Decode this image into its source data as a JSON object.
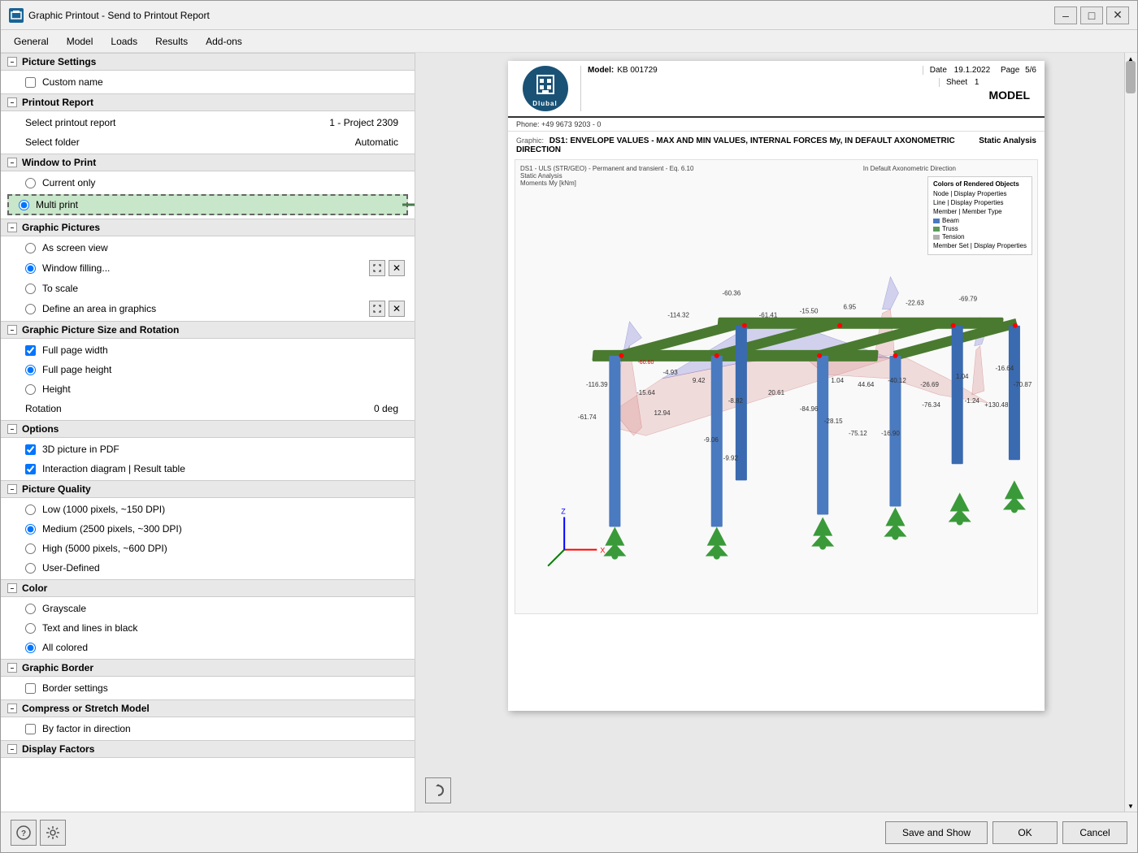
{
  "window": {
    "title": "Graphic Printout - Send to Printout Report",
    "icon": "printer-icon"
  },
  "menu": {
    "items": [
      "General",
      "Model",
      "Loads",
      "Results",
      "Add-ons"
    ]
  },
  "title_controls": [
    "minimize",
    "maximize",
    "close"
  ],
  "sections": {
    "picture_settings": {
      "label": "Picture Settings",
      "custom_name": {
        "label": "Custom name",
        "checked": false
      }
    },
    "printout_report": {
      "label": "Printout Report",
      "select_report": {
        "label": "Select printout report",
        "value": "1 - Project 2309"
      },
      "select_folder": {
        "label": "Select folder",
        "value": "Automatic"
      }
    },
    "window_to_print": {
      "label": "Window to Print",
      "current_only": {
        "label": "Current only",
        "checked": false
      },
      "multi_print": {
        "label": "Multi print",
        "checked": true
      }
    },
    "graphic_pictures": {
      "label": "Graphic Pictures",
      "as_screen_view": {
        "label": "As screen view",
        "checked": false
      },
      "window_filling": {
        "label": "Window filling...",
        "checked": true
      },
      "to_scale": {
        "label": "To scale",
        "checked": false
      },
      "define_area": {
        "label": "Define an area in graphics",
        "checked": false
      }
    },
    "size_rotation": {
      "label": "Graphic Picture Size and Rotation",
      "full_page_width": {
        "label": "Full page width",
        "checked": true
      },
      "full_page_height": {
        "label": "Full page height",
        "checked": true
      },
      "height": {
        "label": "Height",
        "checked": false
      },
      "rotation": {
        "label": "Rotation",
        "value": "0",
        "unit": "deg"
      }
    },
    "options": {
      "label": "Options",
      "pdf_3d": {
        "label": "3D picture in PDF",
        "checked": true
      },
      "interaction_diagram": {
        "label": "Interaction diagram | Result table",
        "checked": true
      }
    },
    "picture_quality": {
      "label": "Picture Quality",
      "low": {
        "label": "Low (1000 pixels, ~150 DPI)",
        "checked": false
      },
      "medium": {
        "label": "Medium (2500 pixels, ~300 DPI)",
        "checked": true
      },
      "high": {
        "label": "High (5000 pixels, ~600 DPI)",
        "checked": false
      },
      "user_defined": {
        "label": "User-Defined",
        "checked": false
      }
    },
    "color": {
      "label": "Color",
      "grayscale": {
        "label": "Grayscale",
        "checked": false
      },
      "text_lines_black": {
        "label": "Text and lines in black",
        "checked": false
      },
      "all_colored": {
        "label": "All colored",
        "checked": true
      }
    },
    "graphic_border": {
      "label": "Graphic Border",
      "border_settings": {
        "label": "Border settings",
        "checked": false
      }
    },
    "compress_stretch": {
      "label": "Compress or Stretch Model",
      "by_factor": {
        "label": "By factor in direction",
        "checked": false
      }
    },
    "display_factors": {
      "label": "Display Factors"
    }
  },
  "preview": {
    "phone": "Phone: +49 9673 9203 - 0",
    "model_label": "Model:",
    "model_value": "KB 001729",
    "date_label": "Date",
    "date_value": "19.1.2022",
    "page_label": "Page",
    "page_value": "5/6",
    "sheet_label": "Sheet",
    "sheet_value": "1",
    "section_title": "MODEL",
    "graphic_prefix": "Graphic:",
    "graphic_title": "DS1: ENVELOPE VALUES - MAX AND MIN VALUES, INTERNAL FORCES My, IN DEFAULT AXONOMETRIC DIRECTION",
    "analysis_type": "Static Analysis",
    "subtitle": "DS1 - ULS (STR/GEO) - Permanent and transient - Eq. 6.10",
    "analysis_label": "Static Analysis",
    "moment_label": "Moments My [kNm]",
    "direction_label": "In Default Axonometric Direction",
    "colors_label": "Colors of Rendered Objects",
    "legend": {
      "node": "Node | Display Properties",
      "line": "Line | Display Properties",
      "member": "Member | Member Type",
      "beam": "Beam",
      "truss": "Truss",
      "tension": "Tension",
      "member_set": "Member Set | Display Properties"
    }
  },
  "buttons": {
    "save_and_show": "Save and Show",
    "ok": "OK",
    "cancel": "Cancel"
  },
  "colors": {
    "beam": "#4a90d9",
    "truss": "#5a8a5a",
    "tension": "#c0c0c0",
    "positive_moment": "#f5c0c0",
    "negative_moment": "#c0c0f5",
    "support": "#3a8a3a",
    "accent_green": "#4caf50"
  }
}
